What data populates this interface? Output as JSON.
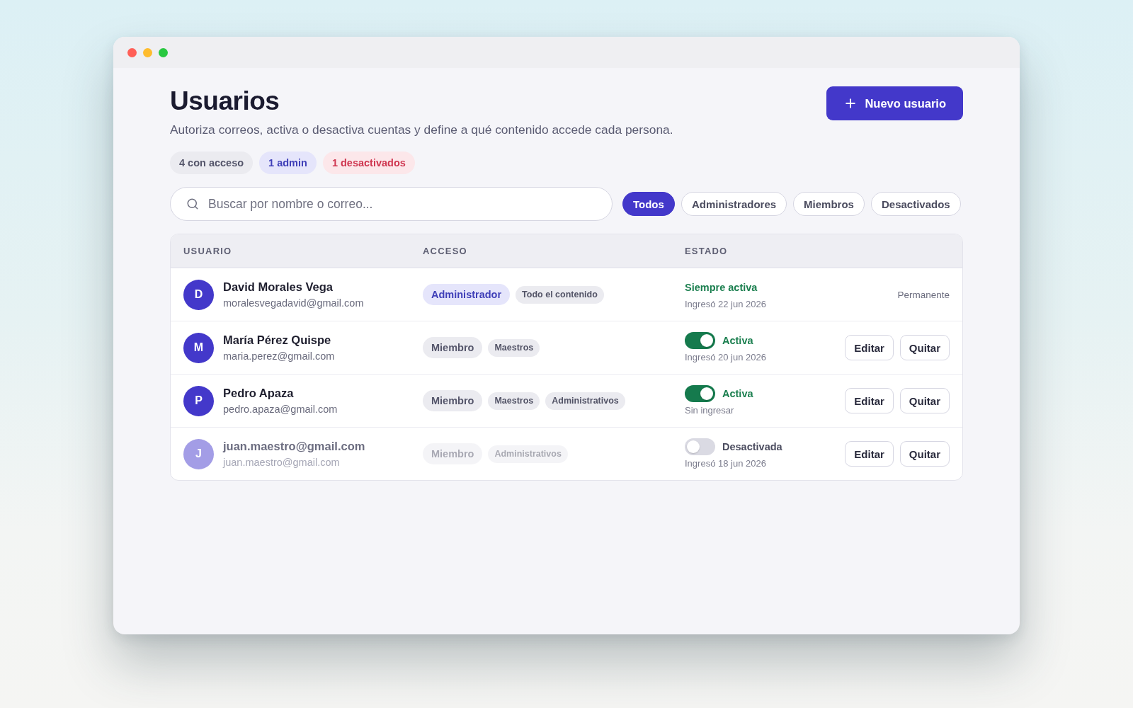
{
  "header": {
    "title": "Usuarios",
    "subtitle": "Autoriza correos, activa o desactiva cuentas y define a qué contenido accede cada persona.",
    "new_button": {
      "label": "Nuevo usuario"
    }
  },
  "summary": [
    {
      "label": "4 con acceso",
      "kind": "neutral"
    },
    {
      "label": "1 admin",
      "kind": "admin"
    },
    {
      "label": "1 desactivados",
      "kind": "danger"
    }
  ],
  "search": {
    "placeholder": "Buscar por nombre o correo..."
  },
  "filters": [
    {
      "label": "Todos",
      "selected": true
    },
    {
      "label": "Administradores",
      "selected": false
    },
    {
      "label": "Miembros",
      "selected": false
    },
    {
      "label": "Desactivados",
      "selected": false
    }
  ],
  "table": {
    "columns": [
      "USUARIO",
      "ACCESO",
      "ESTADO"
    ],
    "rows": [
      {
        "initial": "D",
        "name": "David Morales Vega",
        "email": "moralesvegadavid@gmail.com",
        "disabled": false,
        "role": {
          "label": "Administrador",
          "kind": "admin"
        },
        "content": [
          "Todo el contenido"
        ],
        "status": {
          "kind": "fixed",
          "label": "Siempre activa",
          "detail": "Ingresó 22 jun 2026"
        },
        "note": "Permanente"
      },
      {
        "initial": "M",
        "name": "María Pérez Quispe",
        "email": "maria.perez@gmail.com",
        "disabled": false,
        "role": {
          "label": "Miembro",
          "kind": "member"
        },
        "content": [
          "Maestros"
        ],
        "status": {
          "kind": "toggle",
          "on": true,
          "label": "Activa",
          "detail": "Ingresó 20 jun 2026"
        },
        "actions": [
          "Editar",
          "Quitar"
        ]
      },
      {
        "initial": "P",
        "name": "Pedro Apaza",
        "email": "pedro.apaza@gmail.com",
        "disabled": false,
        "role": {
          "label": "Miembro",
          "kind": "member"
        },
        "content": [
          "Maestros",
          "Administrativos"
        ],
        "status": {
          "kind": "toggle",
          "on": true,
          "label": "Activa",
          "detail": "Sin ingresar"
        },
        "actions": [
          "Editar",
          "Quitar"
        ]
      },
      {
        "initial": "J",
        "name": "juan.maestro@gmail.com",
        "email": "juan.maestro@gmail.com",
        "disabled": true,
        "role": {
          "label": "Miembro",
          "kind": "member"
        },
        "content": [
          "Administrativos"
        ],
        "status": {
          "kind": "toggle",
          "on": false,
          "label": "Desactivada",
          "detail": "Ingresó 18 jun 2026"
        },
        "actions": [
          "Editar",
          "Quitar"
        ]
      }
    ]
  }
}
